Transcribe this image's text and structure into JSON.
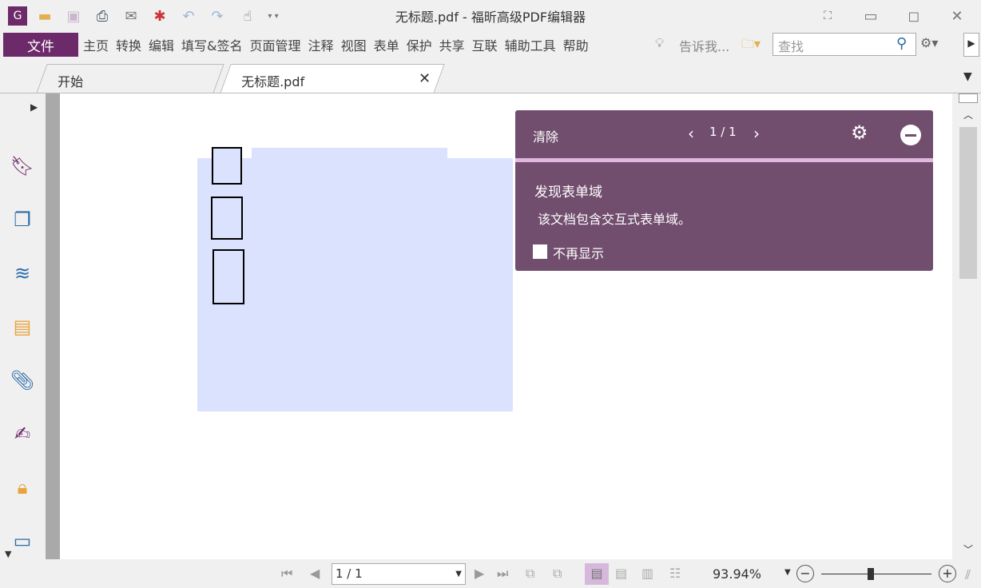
{
  "window": {
    "title": "无标题.pdf - 福昕高级PDF编辑器"
  },
  "menu": {
    "file": "文件",
    "items": [
      "主页",
      "转换",
      "编辑",
      "填写&签名",
      "页面管理",
      "注释",
      "视图",
      "表单",
      "保护",
      "共享",
      "互联",
      "辅助工具",
      "帮助"
    ],
    "tell_me": "告诉我...",
    "search_placeholder": "查找"
  },
  "tabs": [
    {
      "label": "开始"
    },
    {
      "label": "无标题.pdf"
    }
  ],
  "panel": {
    "clear": "清除",
    "pager": "1 / 1",
    "heading": "发现表单域",
    "message": "该文档包含交互式表单域。",
    "dont_show": "不再显示"
  },
  "status": {
    "page": "1 / 1",
    "zoom": "93.94%",
    "zoom_fraction": 0.45
  },
  "colors": {
    "accent": "#6d2a6a",
    "panel": "#714d6e",
    "field": "#dbe2fd"
  }
}
